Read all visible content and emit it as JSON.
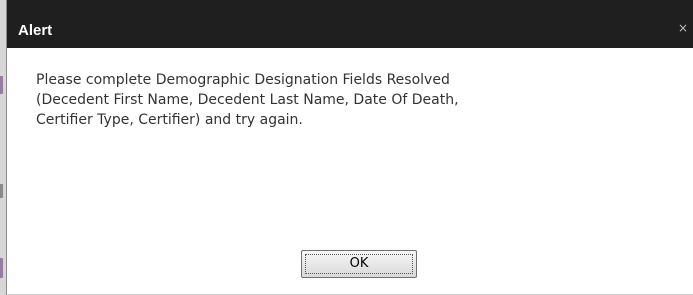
{
  "dialog": {
    "title": "Alert",
    "close_glyph": "×",
    "close_icon": "close-icon",
    "message": "Please complete Demographic Designation Fields Resolved\n(Decedent First Name, Decedent Last Name, Date Of Death,\nCertifier Type, Certifier) and try again.",
    "ok_label": "OK"
  },
  "colors": {
    "titlebar": "#1f1f1f",
    "title_text": "#ffffff",
    "body_text": "#333333",
    "background": "#ffffff"
  }
}
